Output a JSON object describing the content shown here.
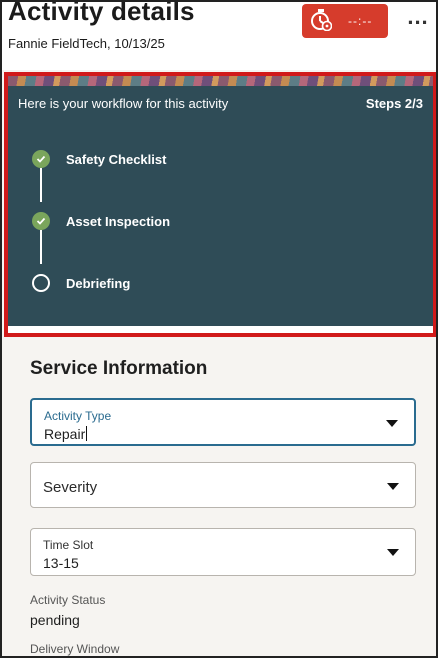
{
  "header": {
    "title": "Activity details",
    "subtitle": "Fannie FieldTech, 10/13/25",
    "timer_text": "--:--",
    "timer_icon": "stopwatch-gear-icon",
    "more_label": "..."
  },
  "workflow": {
    "heading": "Here is your workflow for this activity",
    "steps_label": "Steps 2/3",
    "steps": [
      {
        "label": "Safety Checklist",
        "status": "completed"
      },
      {
        "label": "Asset Inspection",
        "status": "completed"
      },
      {
        "label": "Debriefing",
        "status": "pending"
      }
    ]
  },
  "service_info": {
    "title": "Service Information",
    "fields": [
      {
        "label": "Activity Type",
        "value": "Repair"
      },
      {
        "label": "Severity",
        "value": ""
      },
      {
        "label": "Time Slot",
        "value": "13-15"
      }
    ],
    "readonly": [
      {
        "label": "Activity Status",
        "value": "pending"
      },
      {
        "label": "Delivery Window",
        "value": ""
      }
    ]
  },
  "colors": {
    "accent": "#2a6b8f",
    "timer_bg": "#d63c2c",
    "workflow_bg": "#2f4c57",
    "step_done": "#7aa55c",
    "highlight": "#d11a1a"
  }
}
